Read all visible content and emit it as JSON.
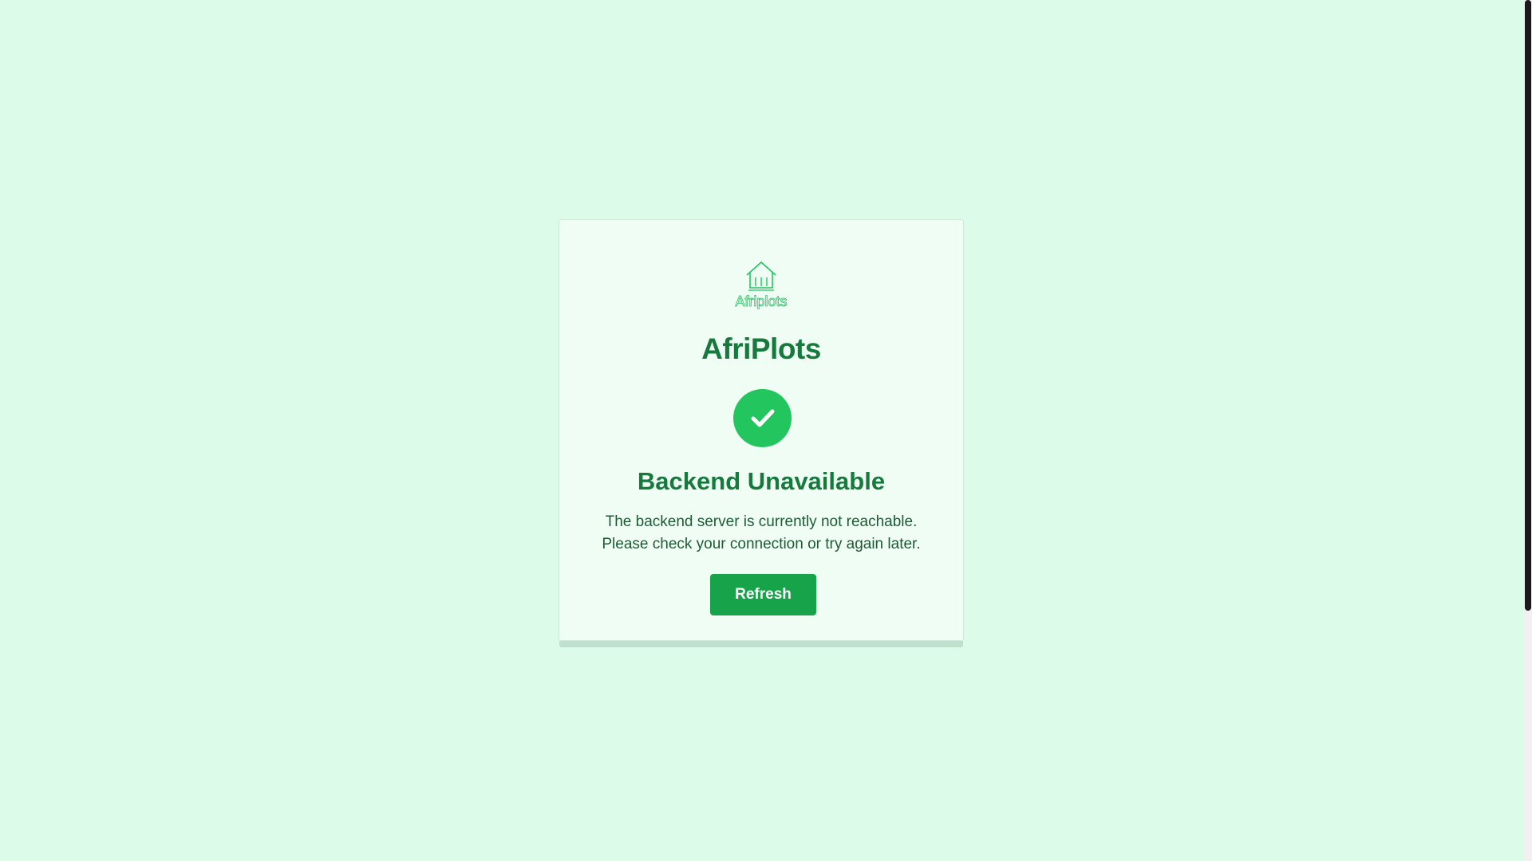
{
  "brand": {
    "logo_text": "Afriplots",
    "name": "AfriPlots"
  },
  "status": {
    "icon": "check-icon",
    "title": "Backend Unavailable",
    "message_line1": "The backend server is currently not reachable.",
    "message_line2": "Please check your connection or try again later."
  },
  "actions": {
    "refresh_label": "Refresh"
  },
  "colors": {
    "background": "#dcfbe8",
    "card": "#effdf4",
    "primary": "#16a34a",
    "accent": "#22c55e",
    "text_dark_green": "#177a3d"
  }
}
